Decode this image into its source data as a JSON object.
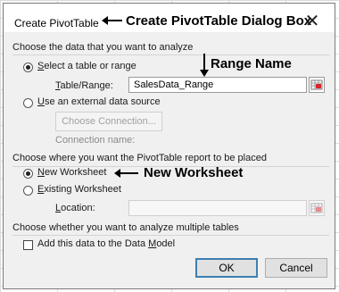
{
  "dialog": {
    "title": "Create PivotTable",
    "close_glyph": "✕"
  },
  "annotations": {
    "dialog_box": "Create PivotTable Dialog Box",
    "range_name": "Range Name",
    "new_worksheet": "New Worksheet"
  },
  "data_source": {
    "heading": "Choose the data that you want to analyze",
    "option_table": {
      "label_ul": "S",
      "label_rest": "elect a table or range",
      "selected": true
    },
    "table_range_label_ul": "T",
    "table_range_label_rest": "able/Range:",
    "table_range_value": "SalesData_Range",
    "option_external": {
      "label_ul": "U",
      "label_rest": "se an external data source",
      "selected": false
    },
    "choose_connection_button": "Choose Connection...",
    "connection_name_label": "Connection name:"
  },
  "placement": {
    "heading": "Choose where you want the PivotTable report to be placed",
    "option_new": {
      "label_ul": "N",
      "label_rest": "ew Worksheet",
      "selected": true
    },
    "option_existing": {
      "label_ul": "E",
      "label_rest": "xisting Worksheet",
      "selected": false
    },
    "location_label_ul": "L",
    "location_label_rest": "ocation:",
    "location_value": ""
  },
  "multiple_tables": {
    "heading": "Choose whether you want to analyze multiple tables",
    "data_model_checkbox": {
      "label_ul": "M",
      "label_pre": "Add this data to the Data ",
      "label_post": "odel",
      "checked": false
    }
  },
  "buttons": {
    "ok": "OK",
    "cancel": "Cancel"
  },
  "icons": {
    "range_picker": "range-picker-icon",
    "arrow": "left-arrow-icon",
    "down_arrow": "down-arrow-icon"
  }
}
